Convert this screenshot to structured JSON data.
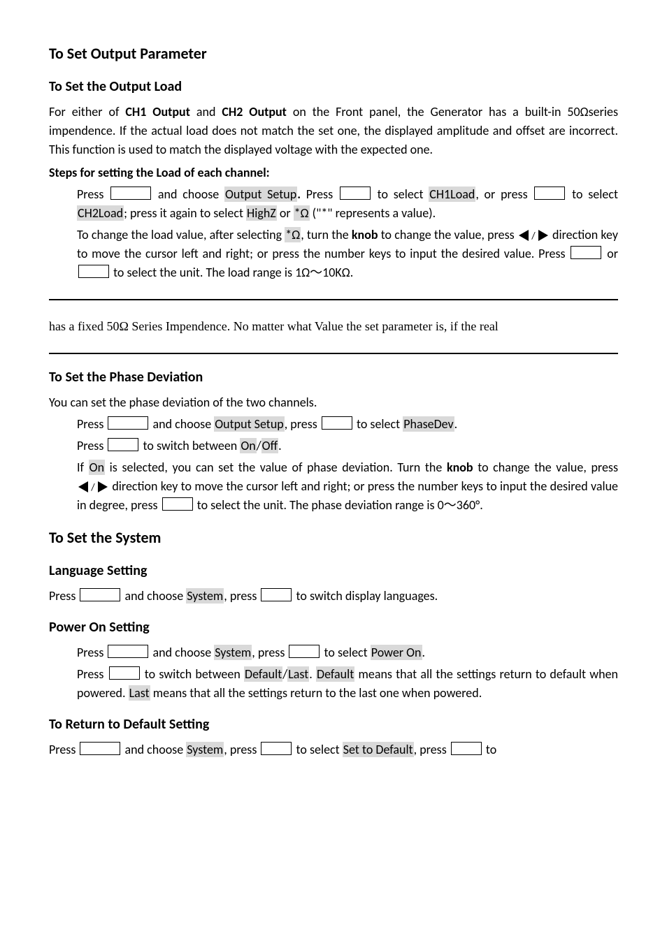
{
  "h_main": "To Set Output Parameter",
  "sec1": {
    "title": "To Set the Output Load",
    "intro_a": "For either of ",
    "ch1": "CH1 Output",
    "intro_b": " and ",
    "ch2": "CH2 Output",
    "intro_c": " on the Front panel, the Generator has a built-in 50Ωseries impendence. If the actual load does not match the set one, the displayed amplitude and offset are incorrect. This function is used to match the displayed voltage with the expected one.",
    "steps_label": "Steps for setting the Load of each channel:",
    "line1a": "Press ",
    "line1b": " and choose ",
    "hl_output_setup": "Output Setup",
    "line1c": " Press ",
    "line1d": " to select ",
    "hl_ch1load": "CH1Load",
    "line1e": ", or press",
    "line2a": " to select ",
    "hl_ch2load": "CH2Load",
    "line2b": "; press it again to select ",
    "hl_highz": "HighZ",
    "line2c": " or ",
    "hl_star_omega": "*Ω",
    "line2d": " (\"*\" represents a value).",
    "line3a": "To change the load value, after selecting ",
    "line3b": ", turn the ",
    "knob": "knob",
    "line3c": " to change the value, press ",
    "line4a": " direction key to move the cursor left and right; or press the number keys to input the desired value. Press ",
    "line4b": " or ",
    "line4c": " to select the unit. The load range is 1Ω～10KΩ."
  },
  "serif_line": "has a fixed 50Ω Series Impendence. No matter what Value the set parameter is, if the real",
  "sec2": {
    "title": "To Set the Phase Deviation",
    "intro": "You can set the phase deviation of the two channels.",
    "l1a": "Press ",
    "l1b": " and choose ",
    "hl_output_setup2": "Output Setup",
    "l1c": ", press ",
    "l1d": " to select ",
    "hl_phasedev": "PhaseDev",
    "l1e": ".",
    "l2a": "Press ",
    "l2b": " to switch between ",
    "hl_on": "On",
    "slash": "/",
    "hl_off": "Off",
    "l2c": ".",
    "l3a": "If ",
    "l3b": " is selected, you can set the value of phase deviation. Turn the ",
    "l3c": " to change the value, press ",
    "l3d": " direction key to move the cursor left and right; or press the number keys to input the desired value in degree, press ",
    "l3e": " to select the unit. The phase deviation range is 0～360°."
  },
  "h_system": "To Set the System",
  "lang": {
    "title": "Language Setting",
    "a": "Press ",
    "b": " and choose ",
    "hl_system": "System",
    "c": ", press ",
    "d": " to switch display languages."
  },
  "power": {
    "title": "Power On Setting",
    "l1a": "Press ",
    "l1b": " and choose ",
    "l1c": ", press ",
    "l1d": " to select ",
    "hl_poweron": "Power On",
    "l1e": ".",
    "l2a": "Press ",
    "l2b": " to switch between ",
    "hl_default": "Default",
    "hl_last": "Last",
    "l2c": ". ",
    "l2d": " means that all the settings return to default when powered. ",
    "l2e": " means that all the settings return to the last one when powered."
  },
  "returnd": {
    "title": "To Return to Default Setting",
    "a": "Press ",
    "b": " and choose ",
    "c": ", press ",
    "d": " to select ",
    "hl_settodefault": "Set to Default",
    "e": ", press ",
    "f": " to"
  }
}
